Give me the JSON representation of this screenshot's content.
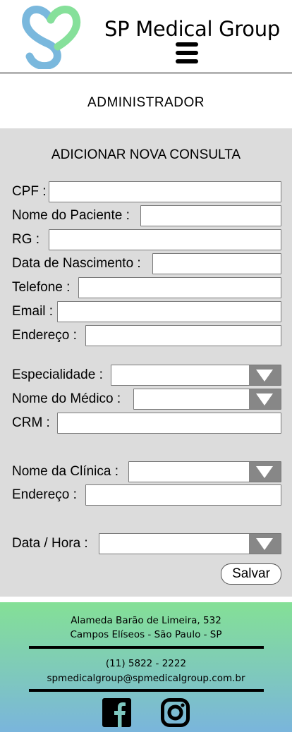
{
  "header": {
    "brand": "SP Medical Group",
    "logo_icon": "heart-s-logo-icon",
    "menu_icon": "hamburger-menu-icon",
    "logo_colors": {
      "blue": "#7ab8dd",
      "green": "#86e09a"
    }
  },
  "page": {
    "role_title": "ADMINISTRADOR"
  },
  "form": {
    "title": "ADICIONAR NOVA CONSULTA",
    "fields": {
      "cpf": {
        "label": "CPF :",
        "value": ""
      },
      "nome_paciente": {
        "label": "Nome do Paciente :",
        "value": ""
      },
      "rg": {
        "label": "RG :",
        "value": ""
      },
      "data_nascimento": {
        "label": "Data de Nascimento :",
        "value": ""
      },
      "telefone": {
        "label": "Telefone :",
        "value": ""
      },
      "email": {
        "label": "Email :",
        "value": ""
      },
      "endereco_paciente": {
        "label": "Endereço :",
        "value": ""
      },
      "especialidade": {
        "label": "Especialidade :",
        "value": ""
      },
      "nome_medico": {
        "label": "Nome do Médico :",
        "value": ""
      },
      "crm": {
        "label": "CRM :",
        "value": ""
      },
      "nome_clinica": {
        "label": "Nome da Clínica :",
        "value": ""
      },
      "endereco_clinica": {
        "label": "Endereço :",
        "value": ""
      },
      "data_hora": {
        "label": "Data / Hora :",
        "value": ""
      }
    },
    "save_label": "Salvar",
    "section_bg": "#dcdcdc",
    "dropdown_bg": "#878787"
  },
  "footer": {
    "address_line1": "Alameda Barão de Limeira, 532",
    "address_line2": "Campos Elíseos - São Paulo - SP",
    "phone": "(11) 5822 - 2222",
    "email": "spmedicalgroup@spmedicalgroup.com.br",
    "social": [
      "facebook-icon",
      "instagram-icon"
    ],
    "gradient": [
      "#84e096",
      "#7ab5dc"
    ]
  }
}
